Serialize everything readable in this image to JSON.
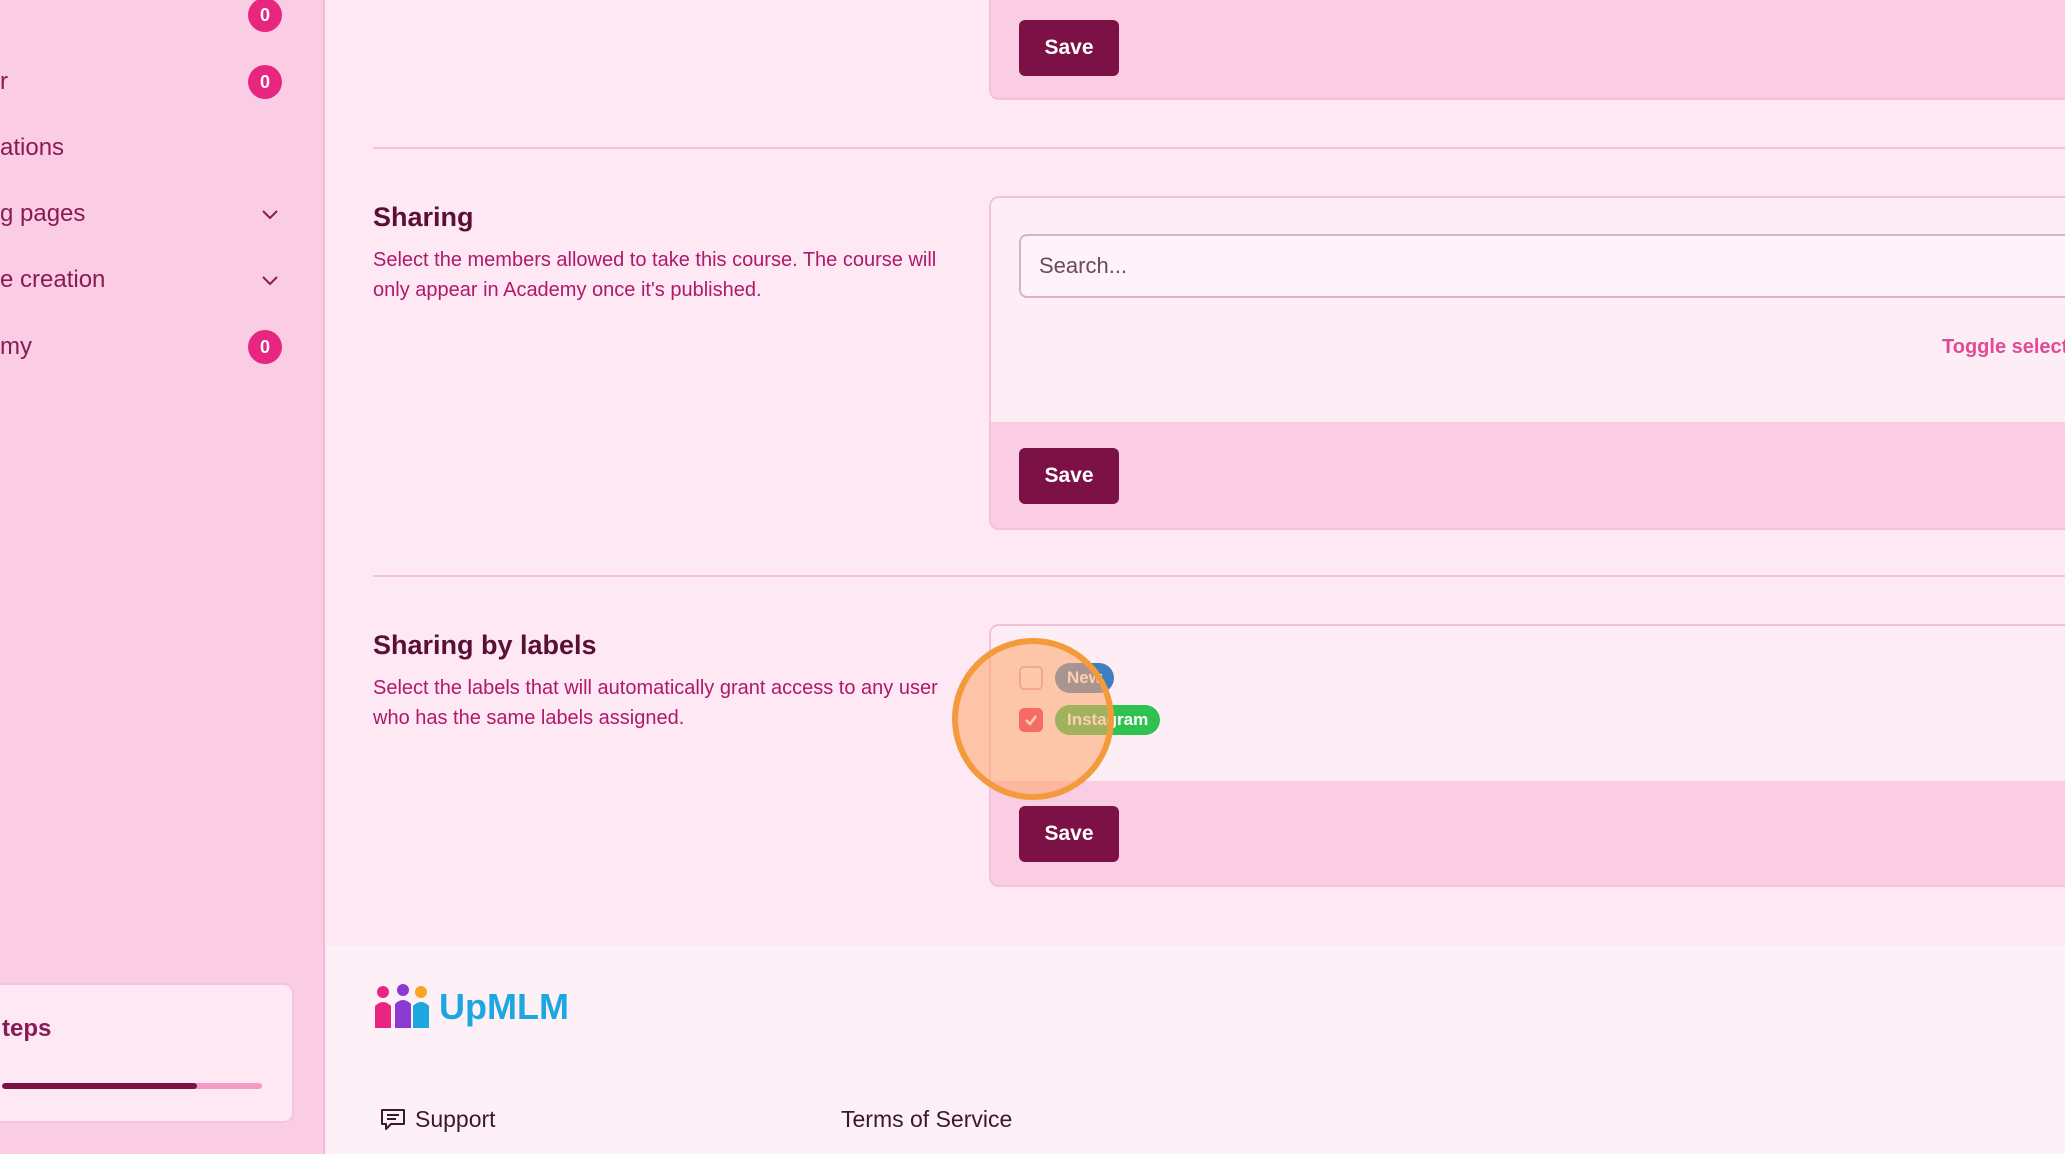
{
  "sidebar": {
    "items": [
      {
        "label": "",
        "badge": "0"
      },
      {
        "label": "r",
        "badge": "0"
      },
      {
        "label": "ations"
      },
      {
        "label": "g pages",
        "icon": "chevron-down-icon"
      },
      {
        "label": "e creation",
        "icon": "chevron-down-icon"
      },
      {
        "label": "my",
        "badge": "0"
      }
    ],
    "steps": {
      "title": "teps",
      "progress": 0.75
    }
  },
  "sections": {
    "top": {
      "save_label": "Save"
    },
    "sharing": {
      "title": "Sharing",
      "description": "Select the members allowed to take this course. The course will only appear in Academy once it's published.",
      "search_placeholder": "Search...",
      "toggle_label": "Toggle select",
      "save_label": "Save"
    },
    "sharing_by_labels": {
      "title": "Sharing by labels",
      "description": "Select the labels that will automatically grant access to any user who has the same labels assigned.",
      "labels": [
        {
          "name": "New",
          "checked": false,
          "color": "#3f7fc0"
        },
        {
          "name": "Instagram",
          "checked": true,
          "color": "#2fc24f"
        }
      ],
      "save_label": "Save"
    }
  },
  "footer": {
    "brand": "UpMLM",
    "links": [
      {
        "label": "Support",
        "icon": "chat-icon"
      },
      {
        "label": "Terms of Service"
      }
    ]
  },
  "colors": {
    "accent": "#7c1145",
    "badge": "#e8267f",
    "sidebar_bg": "#fbcde5",
    "page_bg": "#fde8f3",
    "brand": "#1da7e0"
  }
}
